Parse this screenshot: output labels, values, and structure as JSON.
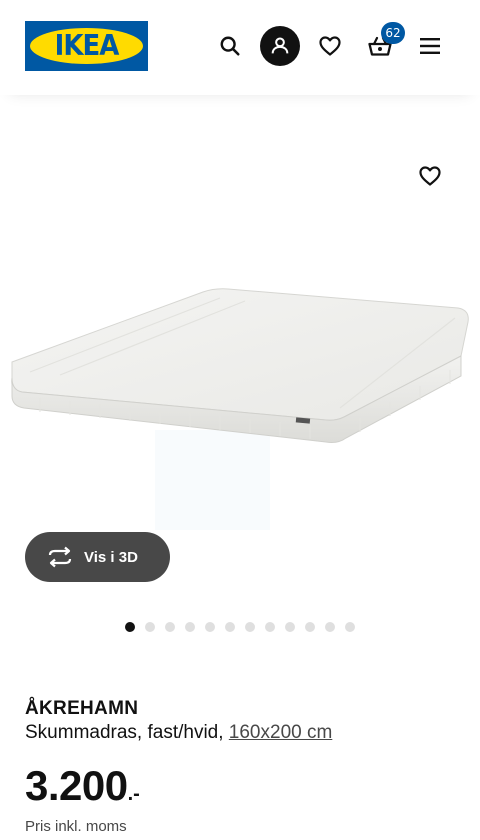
{
  "header": {
    "logo_text": "IKEA",
    "search_icon": "search-icon",
    "account_icon": "user-icon",
    "favourites_icon": "heart-icon",
    "basket_icon": "basket-icon",
    "basket_count": "62",
    "menu_icon": "hamburger-menu-icon"
  },
  "gallery": {
    "favourite_icon": "heart-icon",
    "view_3d_label": "Vis i 3D",
    "view_3d_icon": "rotate-3d-icon",
    "image_count": 12,
    "active_image": 1
  },
  "product": {
    "name": "ÅKREHAMN",
    "description": "Skummadras, fast/hvid, ",
    "size_link": "160x200 cm",
    "price": "3.200",
    "price_suffix": ".-",
    "price_note": "Pris inkl. moms"
  },
  "colors": {
    "brand_blue": "#0058a3",
    "brand_yellow": "#ffdb00",
    "button_dark": "#484848"
  }
}
